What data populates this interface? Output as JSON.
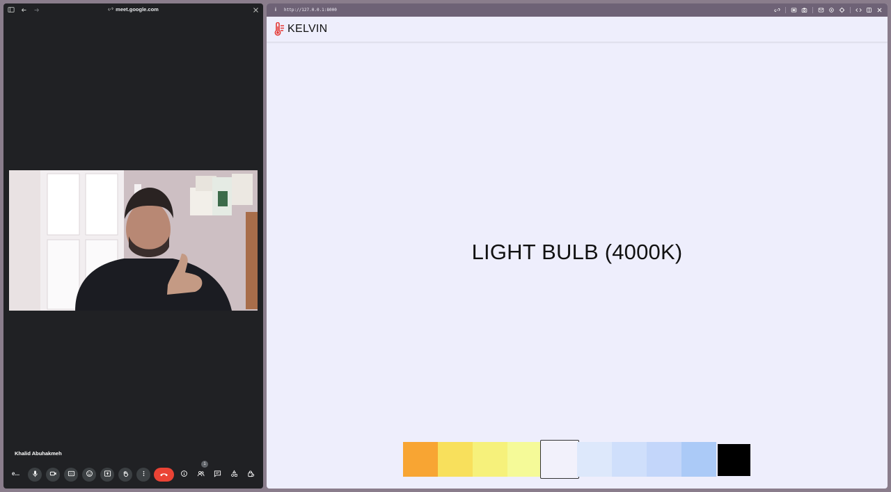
{
  "meet": {
    "url": "meet.google.com",
    "participant_name": "Khalid Abuhakmeh",
    "meeting_code_truncated": "e...",
    "people_count": "1",
    "icons": {
      "sidebar": "sidebar-toggle-icon",
      "back": "back-arrow-icon",
      "forward": "forward-arrow-icon",
      "link": "link-icon",
      "close": "close-icon",
      "mic": "microphone-icon",
      "camera": "camera-icon",
      "captions": "captions-icon",
      "emoji": "emoji-icon",
      "present": "present-screen-icon",
      "hand": "raise-hand-icon",
      "more": "more-options-icon",
      "end": "end-call-icon",
      "info": "meeting-info-icon",
      "people": "people-icon",
      "chat": "chat-icon",
      "activities": "activities-icon",
      "host": "host-controls-icon"
    },
    "colors": {
      "background": "#202124",
      "end_call": "#ea4335",
      "control": "#3c4043"
    }
  },
  "kelvin": {
    "url": "http://127.0.0.1:8000",
    "brand": "KELVIN",
    "title": "LIGHT BULB (4000K)",
    "colors": {
      "background": "#eeeefc",
      "logo": "#e53935",
      "toolbar": "#6e6276"
    },
    "swatches": [
      {
        "name": "swatch-1",
        "color": "#f8a533",
        "selected": false
      },
      {
        "name": "swatch-2",
        "color": "#f8e05c",
        "selected": false
      },
      {
        "name": "swatch-3",
        "color": "#f6f17b",
        "selected": false
      },
      {
        "name": "swatch-4",
        "color": "#f5fa98",
        "selected": false
      },
      {
        "name": "swatch-5",
        "color": "#f2f1fb",
        "selected": true
      },
      {
        "name": "swatch-6",
        "color": "#dde8fb",
        "selected": false
      },
      {
        "name": "swatch-7",
        "color": "#cfdffb",
        "selected": false
      },
      {
        "name": "swatch-8",
        "color": "#c3d6fa",
        "selected": false
      },
      {
        "name": "swatch-9",
        "color": "#abcaf7",
        "selected": false
      },
      {
        "name": "swatch-10",
        "color": "#000000",
        "selected": false
      }
    ]
  }
}
